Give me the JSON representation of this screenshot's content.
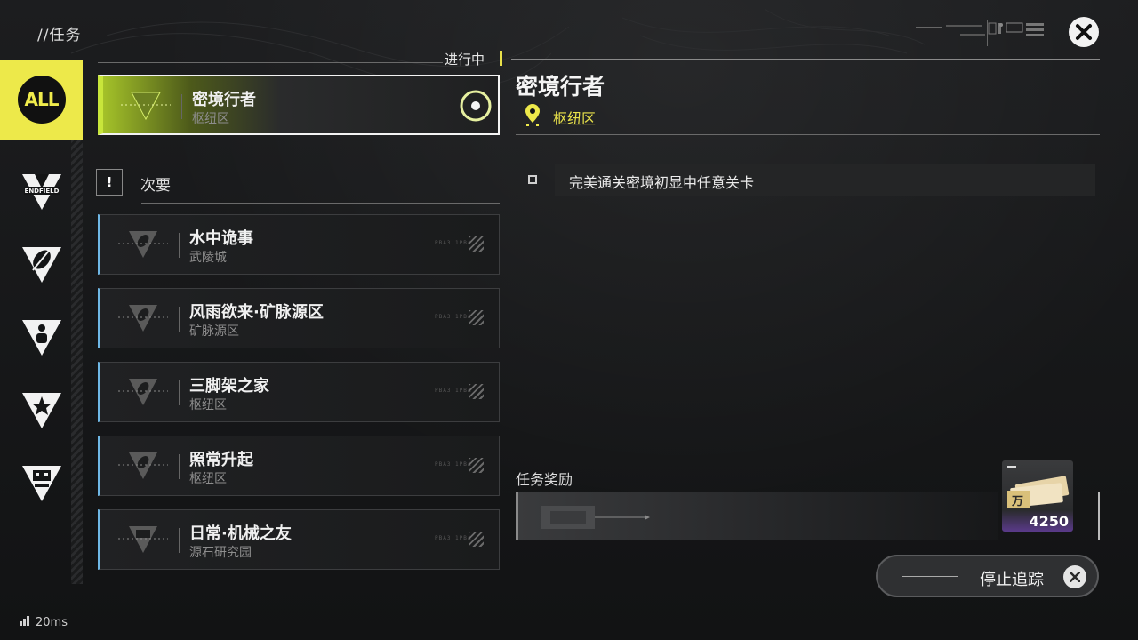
{
  "header": {
    "title": "//任务",
    "in_progress_label": "进行中"
  },
  "sidebar": {
    "items": [
      {
        "name": "all",
        "label": "ALL",
        "icon": "all-icon",
        "active": true
      },
      {
        "name": "endfield",
        "label": "ENDFIELD",
        "icon": "endfield-icon",
        "active": false
      },
      {
        "name": "leaf",
        "label": "",
        "icon": "leaf-triangle-icon",
        "active": false
      },
      {
        "name": "person",
        "label": "",
        "icon": "person-triangle-icon",
        "active": false
      },
      {
        "name": "star",
        "label": "",
        "icon": "star-triangle-icon",
        "active": false
      },
      {
        "name": "robot",
        "label": "",
        "icon": "robot-triangle-icon",
        "active": false
      }
    ]
  },
  "tracked_quest": {
    "name": "密境行者",
    "location": "枢纽区"
  },
  "secondary": {
    "marker": "!",
    "label": "次要"
  },
  "quests": [
    {
      "name": "水中诡事",
      "location": "武陵城",
      "code": "PBA3 1PBA"
    },
    {
      "name": "风雨欲来·矿脉源区",
      "location": "矿脉源区",
      "code": "PBA3 1PBA"
    },
    {
      "name": "三脚架之家",
      "location": "枢纽区",
      "code": "PBA3 1PBA"
    },
    {
      "name": "照常升起",
      "location": "枢纽区",
      "code": "PBA3 1PBA"
    },
    {
      "name": "日常·机械之友",
      "location": "源石研究园",
      "code": "PBA3 1PBA"
    }
  ],
  "detail": {
    "title": "密境行者",
    "location": "枢纽区",
    "objective": "完美通关密境初显中任意关卡",
    "reward_label": "任务奖励",
    "reward_count": "4250"
  },
  "stop_tracking_label": "停止追踪",
  "ping": "20ms",
  "colors": {
    "accent_yellow": "#ede94a",
    "accent_blue": "#6fb8e6",
    "accent_green": "#c8e63b"
  }
}
